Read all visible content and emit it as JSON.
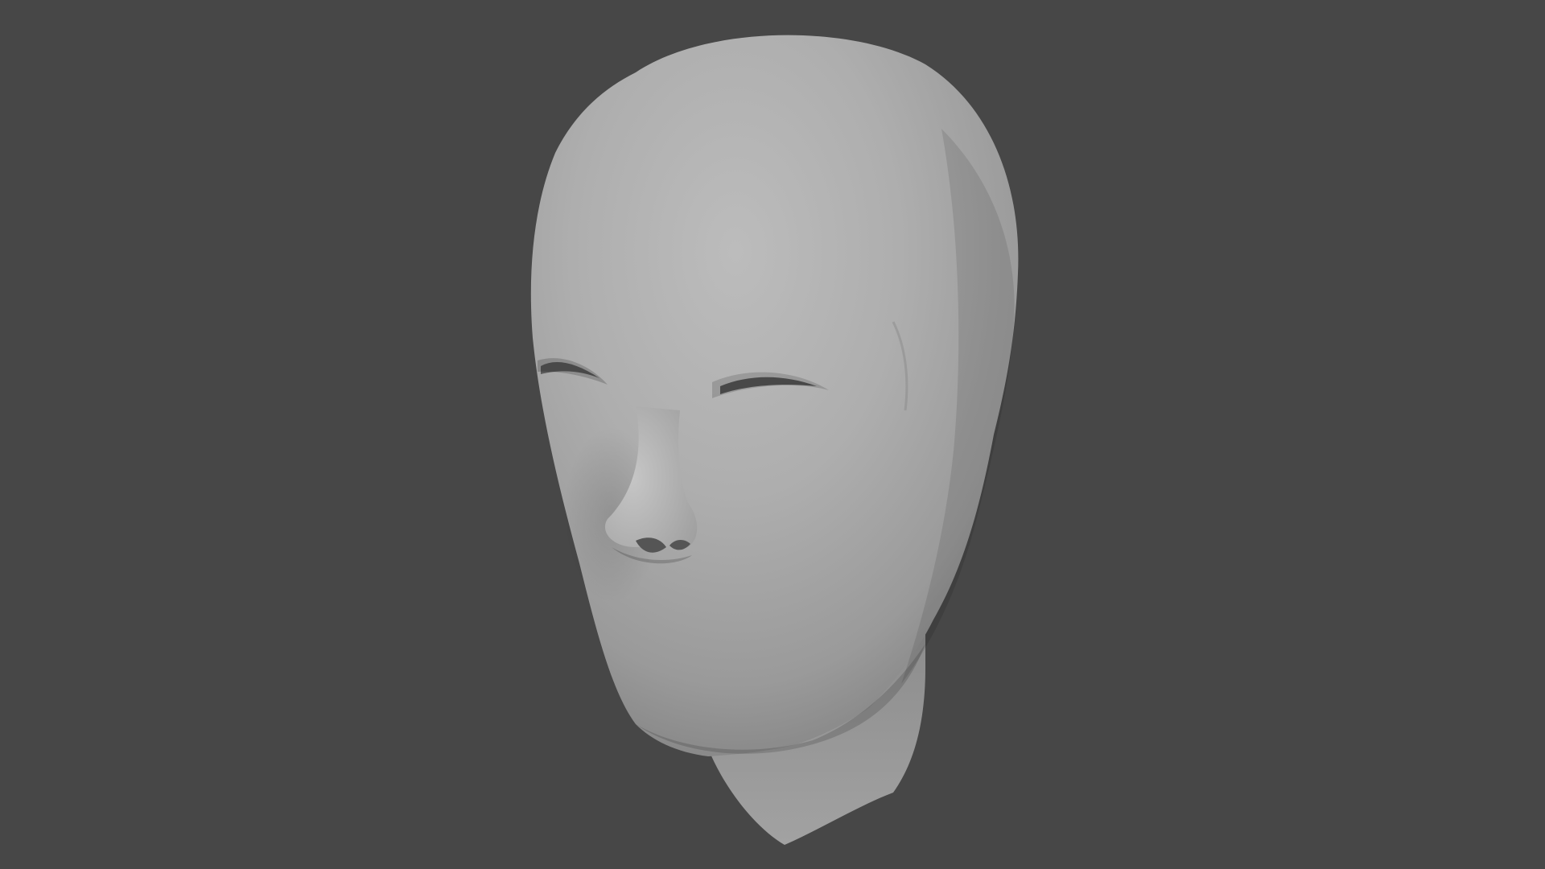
{
  "viewport": {
    "background": "#474747",
    "object": "head-mesh",
    "shading": "solid",
    "mesh_color": "#a9a9a9"
  }
}
